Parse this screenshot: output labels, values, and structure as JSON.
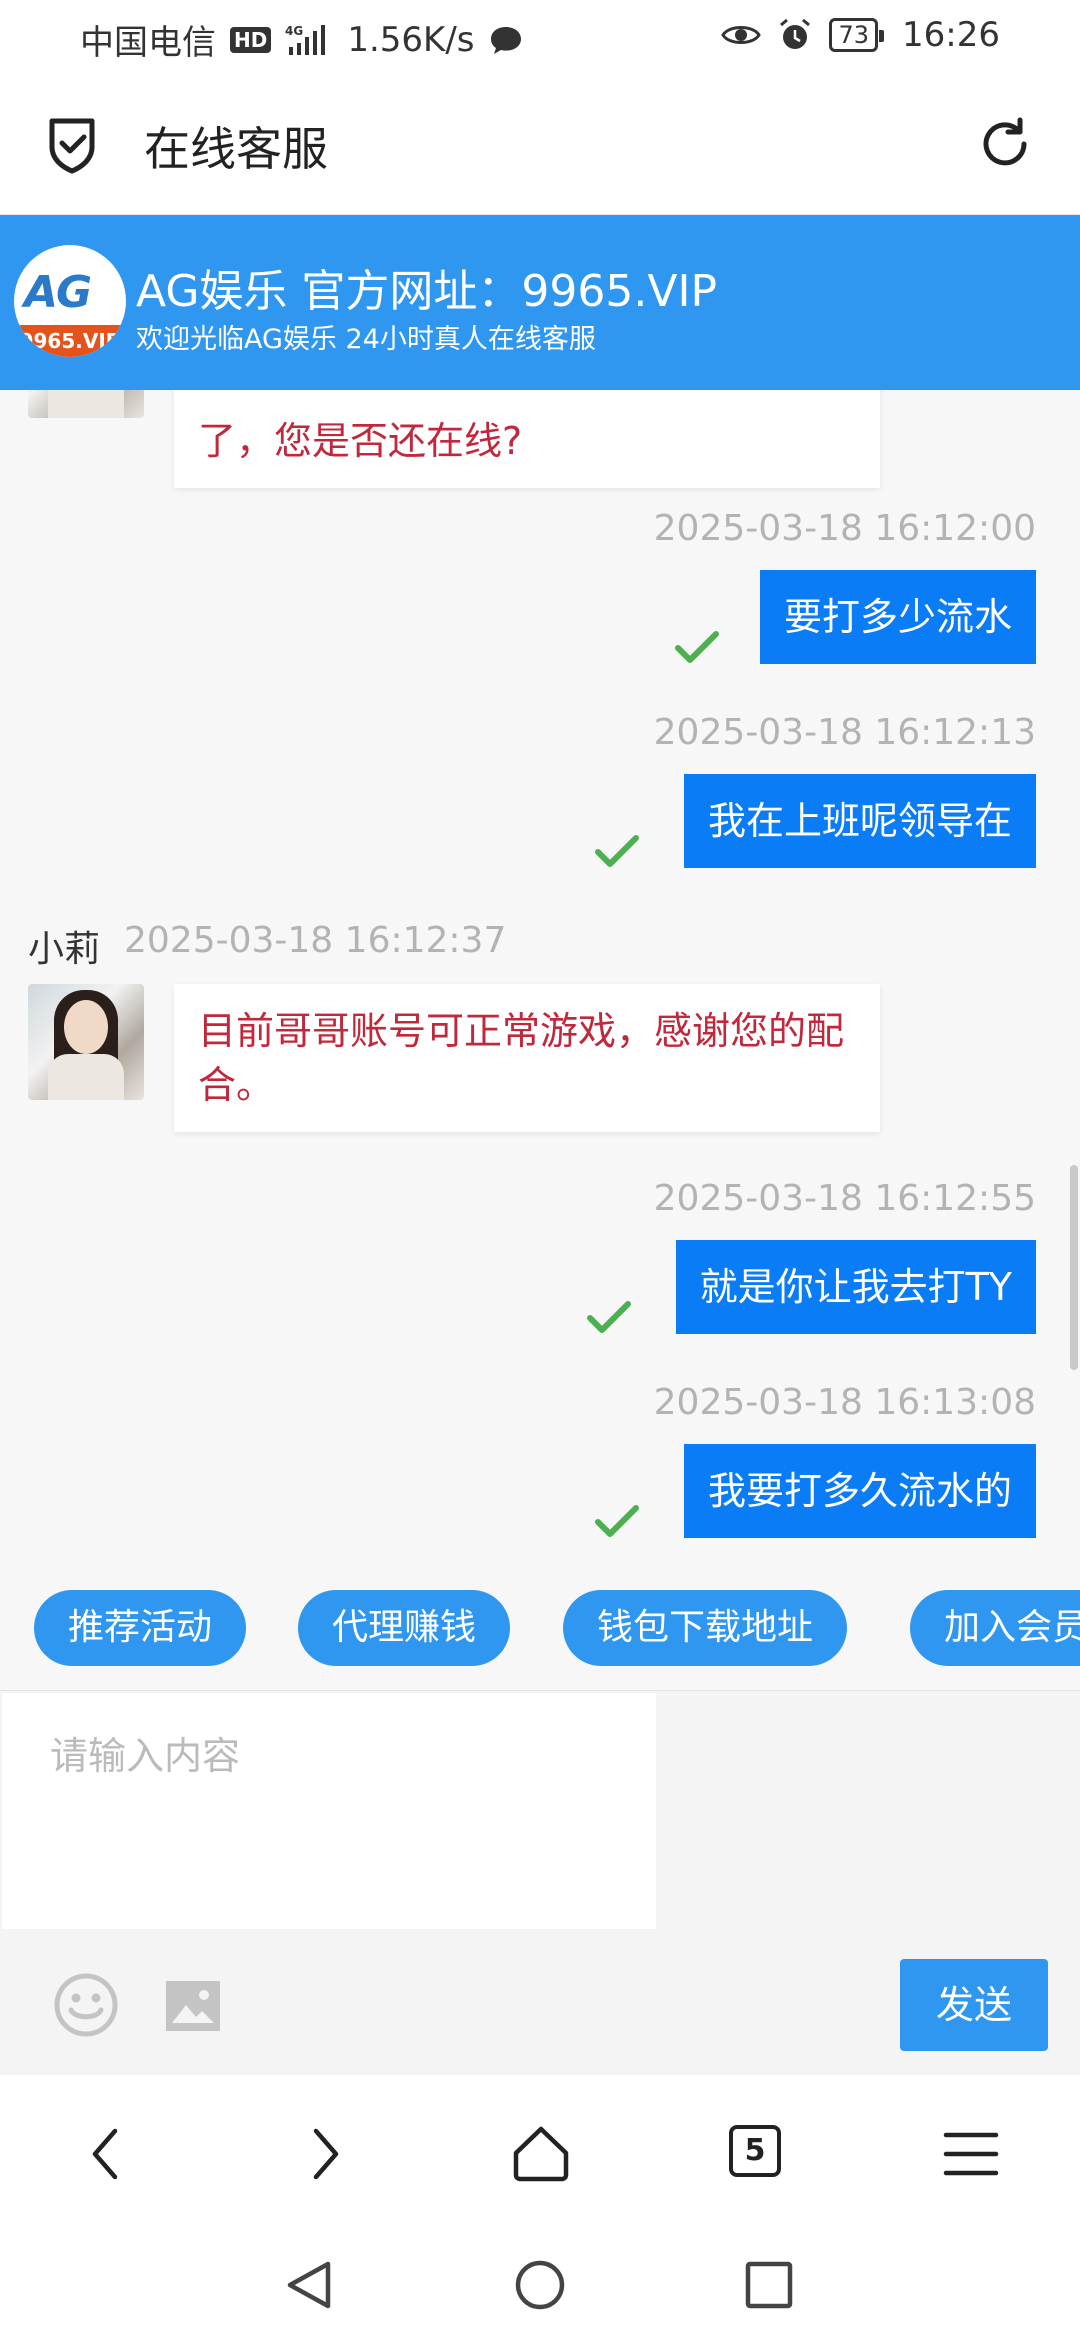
{
  "status_bar": {
    "carrier": "中国电信",
    "hd": "HD",
    "net_type": "4G",
    "speed": "1.56K/s",
    "battery": "73",
    "time": "16:26"
  },
  "header": {
    "title": "在线客服"
  },
  "banner": {
    "logo_text": "AG",
    "logo_sub": "9965.VIP",
    "title": "AG娱乐 官方网址：9965.VIP",
    "subtitle": "欢迎光临AG娱乐 24小时真人在线客服"
  },
  "messages": [
    {
      "direction": "in",
      "text": "了，您是否还在线?"
    },
    {
      "direction": "out",
      "time": "2025-03-18 16:12:00",
      "text": "要打多少流水"
    },
    {
      "direction": "out",
      "time": "2025-03-18 16:12:13",
      "text": "我在上班呢领导在"
    },
    {
      "direction": "in",
      "sender": "小莉",
      "time": "2025-03-18 16:12:37",
      "text": "目前哥哥账号可正常游戏，感谢您的配合。"
    },
    {
      "direction": "out",
      "time": "2025-03-18 16:12:55",
      "text": "就是你让我去打TY"
    },
    {
      "direction": "out",
      "time": "2025-03-18 16:13:08",
      "text": "我要打多久流水的"
    }
  ],
  "quick_actions": [
    "推荐活动",
    "代理赚钱",
    "钱包下载地址",
    "加入会员"
  ],
  "input": {
    "placeholder": "请输入内容",
    "send_label": "发送"
  },
  "browser": {
    "tab_count": "5"
  },
  "colors": {
    "brand_blue": "#2f97f0",
    "out_bubble": "#0a7cf6",
    "in_text": "#c0283c",
    "read_check": "#4caf50"
  }
}
